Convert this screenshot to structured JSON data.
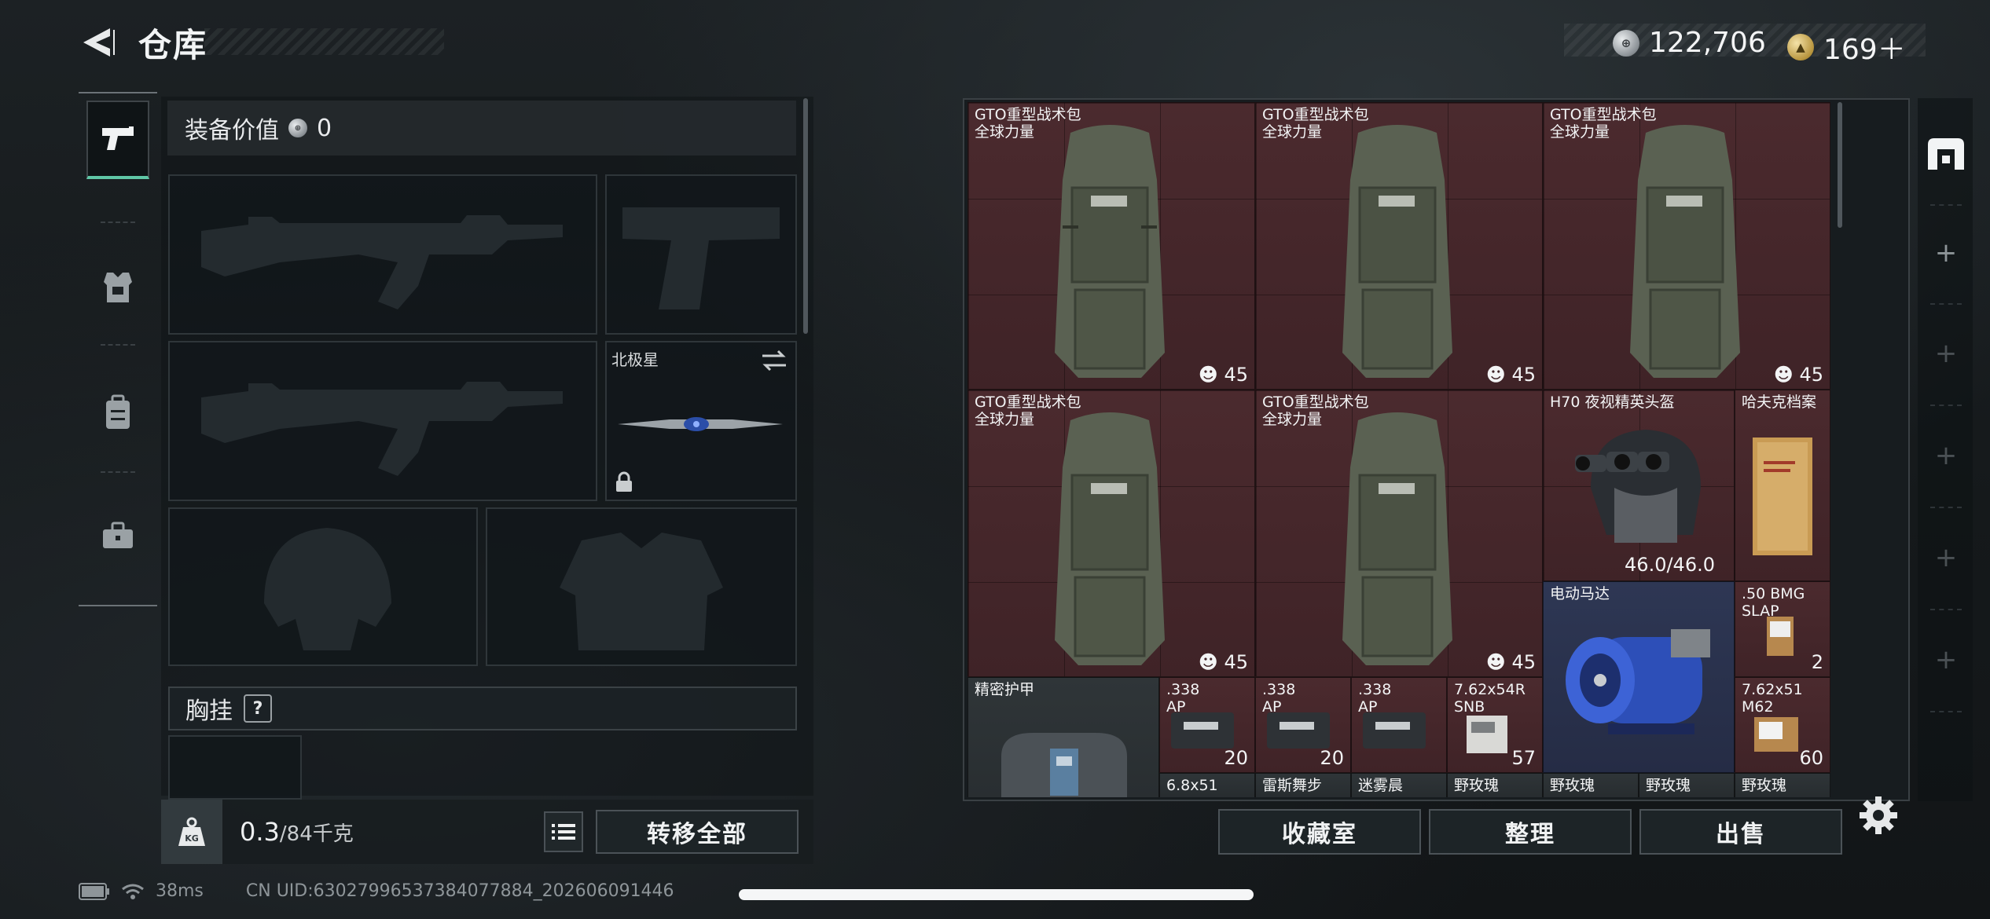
{
  "header": {
    "title": "仓库",
    "back_icon": "back-arrow-icon",
    "currency": [
      {
        "icon": "silver-coin-icon",
        "value": "122,706"
      },
      {
        "icon": "gold-coin-icon",
        "value": "169＋"
      }
    ]
  },
  "rail": {
    "items": [
      {
        "name": "weapons",
        "icon": "pistol-icon"
      },
      {
        "name": "armor",
        "icon": "vest-icon"
      },
      {
        "name": "backpack",
        "icon": "backpack-icon"
      },
      {
        "name": "supplies",
        "icon": "toolbox-icon"
      }
    ]
  },
  "equipment": {
    "value_label": "装备价值",
    "value": "0",
    "melee_label": "北极星",
    "chest_label": "胸挂",
    "chest_help": "?"
  },
  "weight": {
    "current": "0.3",
    "max": "/84千克"
  },
  "buttons": {
    "transfer_all": "转移全部",
    "collection": "收藏室",
    "organize": "整理",
    "sell": "出售"
  },
  "storage": {
    "backpacks": [
      {
        "name": "GTO重型战术包\n全球力量",
        "count": "45"
      },
      {
        "name": "GTO重型战术包\n全球力量",
        "count": "45"
      },
      {
        "name": "GTO重型战术包\n全球力量",
        "count": "45"
      },
      {
        "name": "GTO重型战术包\n全球力量",
        "count": "45"
      },
      {
        "name": "GTO重型战术包\n全球力量",
        "count": "45"
      }
    ],
    "helmet": {
      "name": "H70 夜视精英头盔",
      "durability": "46.0/46.0"
    },
    "dossier": {
      "name": "哈夫克档案"
    },
    "motor": {
      "name": "电动马达"
    },
    "bmg": {
      "name": ".50 BMG\nSLAP",
      "count": "2"
    },
    "armor": {
      "name": "精密护甲"
    },
    "ammo_boxes": [
      {
        "name": ".338\nAP",
        "count": "20"
      },
      {
        "name": ".338\nAP",
        "count": "20"
      },
      {
        "name": ".338\nAP",
        "count": ""
      },
      {
        "name": "7.62x54R\nSNB",
        "count": "57"
      }
    ],
    "m62": {
      "name": "7.62x51\nM62",
      "count": "60"
    },
    "bottom_row": [
      "6.8x51",
      "雷斯舞步",
      "迷雾晨",
      "野玫瑰",
      "野玫瑰",
      "野玫瑰",
      "野玫瑰"
    ]
  },
  "status": {
    "ping": "38ms",
    "uid": "CN UID:6302799653738407788​4_202606091446"
  }
}
